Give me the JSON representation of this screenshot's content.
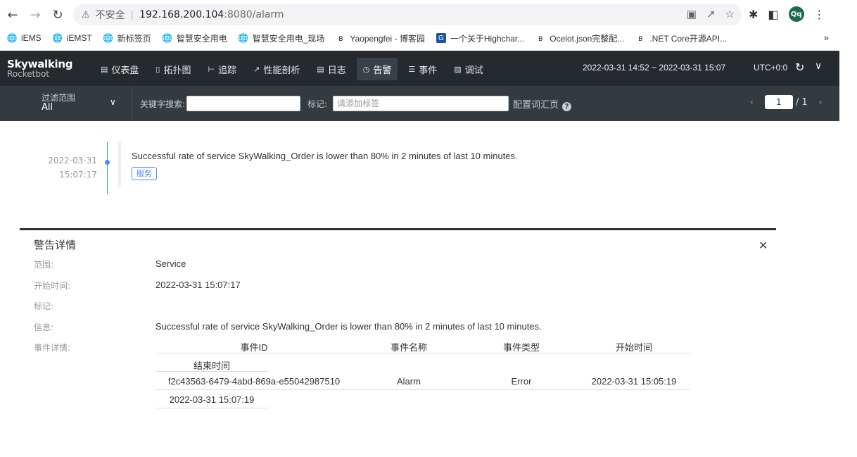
{
  "browser": {
    "insecure_label": "不安全",
    "url_host": "192.168.200.104",
    "url_path": ":8080/alarm",
    "avatar_text": "Qq",
    "bookmarks": [
      {
        "icon": "globe-icon",
        "label": "iEMS"
      },
      {
        "icon": "globe-icon",
        "label": "iEMST"
      },
      {
        "icon": "globe-icon",
        "label": "新标签页"
      },
      {
        "icon": "globe-icon",
        "label": "智慧安全用电"
      },
      {
        "icon": "globe-icon",
        "label": "智慧安全用电_现场"
      },
      {
        "icon": "cnblogs-icon",
        "label": "Yaopengfei - 博客园"
      },
      {
        "icon": "highcharts-icon",
        "label": "一个关于Highchar..."
      },
      {
        "icon": "cnblogs-icon",
        "label": "Ocelot.json完整配..."
      },
      {
        "icon": "cnblogs-icon",
        "label": ".NET Core开源API..."
      }
    ],
    "bookmarks_more": "»"
  },
  "header": {
    "logo_line1": "Skywalking",
    "logo_line2": "Rocketbot",
    "nav": [
      {
        "icon": "dashboard-icon",
        "label": "仪表盘",
        "active": false
      },
      {
        "icon": "topology-icon",
        "label": "拓扑图",
        "active": false
      },
      {
        "icon": "trace-icon",
        "label": "追踪",
        "active": false
      },
      {
        "icon": "profile-icon",
        "label": "性能剖析",
        "active": false
      },
      {
        "icon": "log-icon",
        "label": "日志",
        "active": false
      },
      {
        "icon": "alarm-icon",
        "label": "告警",
        "active": true
      },
      {
        "icon": "event-icon",
        "label": "事件",
        "active": false
      },
      {
        "icon": "debug-icon",
        "label": "调试",
        "active": false
      }
    ],
    "time_range": "2022-03-31 14:52 ~ 2022-03-31 15:07",
    "timezone": "UTC+0:0"
  },
  "filter": {
    "scope_label": "过滤范围",
    "scope_value": "All",
    "keyword_label": "关键字搜索:",
    "keyword_value": "",
    "tag_label": "标记:",
    "tag_placeholder": "请添加标签",
    "vocab_label": "配置词汇页",
    "page_current": "1",
    "page_total": "/ 1"
  },
  "timeline": {
    "date": "2022-03-31",
    "time": "15:07:17",
    "message": "Successful rate of service SkyWalking_Order is lower than 80% in 2 minutes of last 10 minutes.",
    "tag": "服务"
  },
  "detail": {
    "title": "警告详情",
    "scope_label": "范围:",
    "scope_value": "Service",
    "start_label": "开始时间:",
    "start_value": "2022-03-31 15:07:17",
    "tags_label": "标记:",
    "message_label": "信息:",
    "message_value": "Successful rate of service SkyWalking_Order is lower than 80% in 2 minutes of last 10 minutes.",
    "events_label": "事件详情:",
    "table": {
      "headers": [
        "事件ID",
        "事件名称",
        "事件类型",
        "开始时间",
        "结束时间"
      ],
      "rows": [
        {
          "id": "f2c43563-6479-4abd-869a-e55042987510",
          "name": "Alarm",
          "type": "Error",
          "start": "2022-03-31 15:05:19",
          "end": "2022-03-31 15:07:19"
        }
      ]
    }
  }
}
